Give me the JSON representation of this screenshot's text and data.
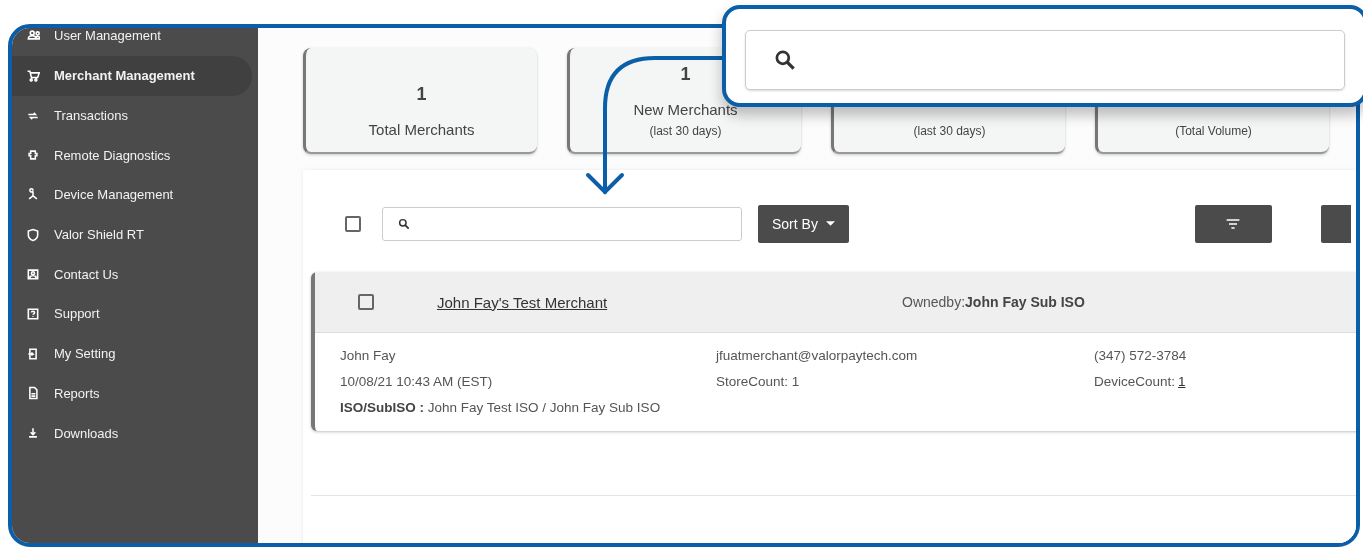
{
  "sidebar": {
    "items": [
      {
        "label": "User Management",
        "selected": false
      },
      {
        "label": "Merchant Management",
        "selected": true
      },
      {
        "label": "Transactions",
        "selected": false
      },
      {
        "label": "Remote Diagnostics",
        "selected": false
      },
      {
        "label": "Device Management",
        "selected": false
      },
      {
        "label": "Valor Shield RT",
        "selected": false
      },
      {
        "label": "Contact Us",
        "selected": false
      },
      {
        "label": "Support",
        "selected": false
      },
      {
        "label": "My Setting",
        "selected": false
      },
      {
        "label": "Reports",
        "selected": false
      },
      {
        "label": "Downloads",
        "selected": false
      }
    ]
  },
  "stats": [
    {
      "value": "1",
      "label": "Total Merchants"
    },
    {
      "value": "1",
      "label": "New Merchants",
      "note": "(last 30 days)"
    },
    {
      "note": "(last 30 days)"
    },
    {
      "note": "(Total Volume)"
    }
  ],
  "toolbar": {
    "select_all_checked": false,
    "sort_button": "Sort By"
  },
  "merchants": [
    {
      "checked": false,
      "name": "John Fay's Test Merchant",
      "owned_by_label": "Ownedby:",
      "owned_by": "John Fay Sub ISO",
      "contact": "John Fay",
      "email": "jfuatmerchant@valorpaytech.com",
      "phone": "(347) 572-3784",
      "created": "10/08/21 10:43 AM (EST)",
      "store_count": "StoreCount: 1",
      "device_count_label": "DeviceCount:",
      "device_count": "1",
      "iso_label": "ISO/SubISO :",
      "iso": "John Fay Test ISO / John Fay Sub ISO"
    }
  ]
}
